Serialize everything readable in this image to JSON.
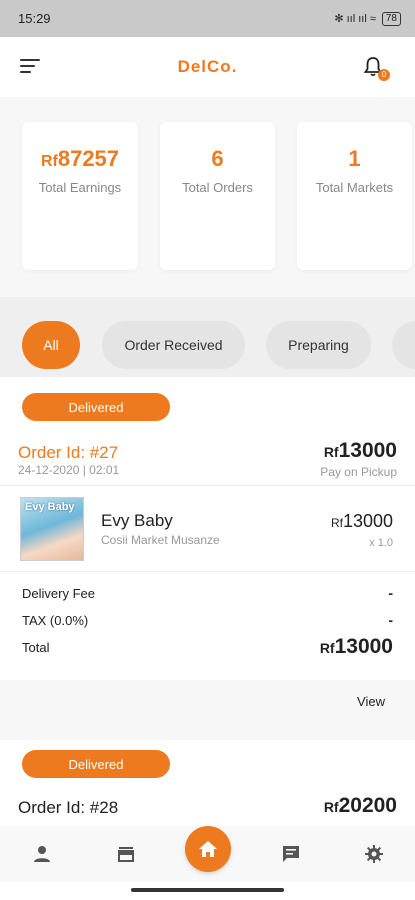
{
  "status_bar": {
    "time": "15:29",
    "indicators": "✻ ııl ııl ≈",
    "battery": "78"
  },
  "app_bar": {
    "brand": "DelCo.",
    "notification_count": "0"
  },
  "stats": [
    {
      "currency": "Rf",
      "value": "87257",
      "label": "Total Earnings"
    },
    {
      "value": "6",
      "label": "Total Orders"
    },
    {
      "value": "1",
      "label": "Total Markets"
    }
  ],
  "filters": [
    {
      "label": "All",
      "active": true
    },
    {
      "label": "Order Received",
      "active": false
    },
    {
      "label": "Preparing",
      "active": false
    }
  ],
  "orders": [
    {
      "status": "Delivered",
      "title": "Order Id: #27",
      "date": "24-12-2020 | 02:01",
      "currency": "Rf",
      "amount": "13000",
      "payment": "Pay on Pickup",
      "item": {
        "image_text": "Evy Baby",
        "name": "Evy Baby",
        "market": "Cosii Market Musanze",
        "currency": "Rf",
        "price": "13000",
        "qty": "x 1.0"
      },
      "delivery_fee_label": "Delivery Fee",
      "delivery_fee": "-",
      "tax_label": "TAX (0.0%)",
      "tax": "-",
      "total_label": "Total",
      "total_currency": "Rf",
      "total": "13000",
      "view_label": "View"
    },
    {
      "status": "Delivered",
      "title": "Order Id: #28",
      "currency": "Rf",
      "amount": "20200"
    }
  ],
  "colors": {
    "accent": "#ee7a1f"
  },
  "bottom_nav": [
    "person-icon",
    "store-icon",
    "home-icon",
    "chat-icon",
    "gear-icon"
  ]
}
